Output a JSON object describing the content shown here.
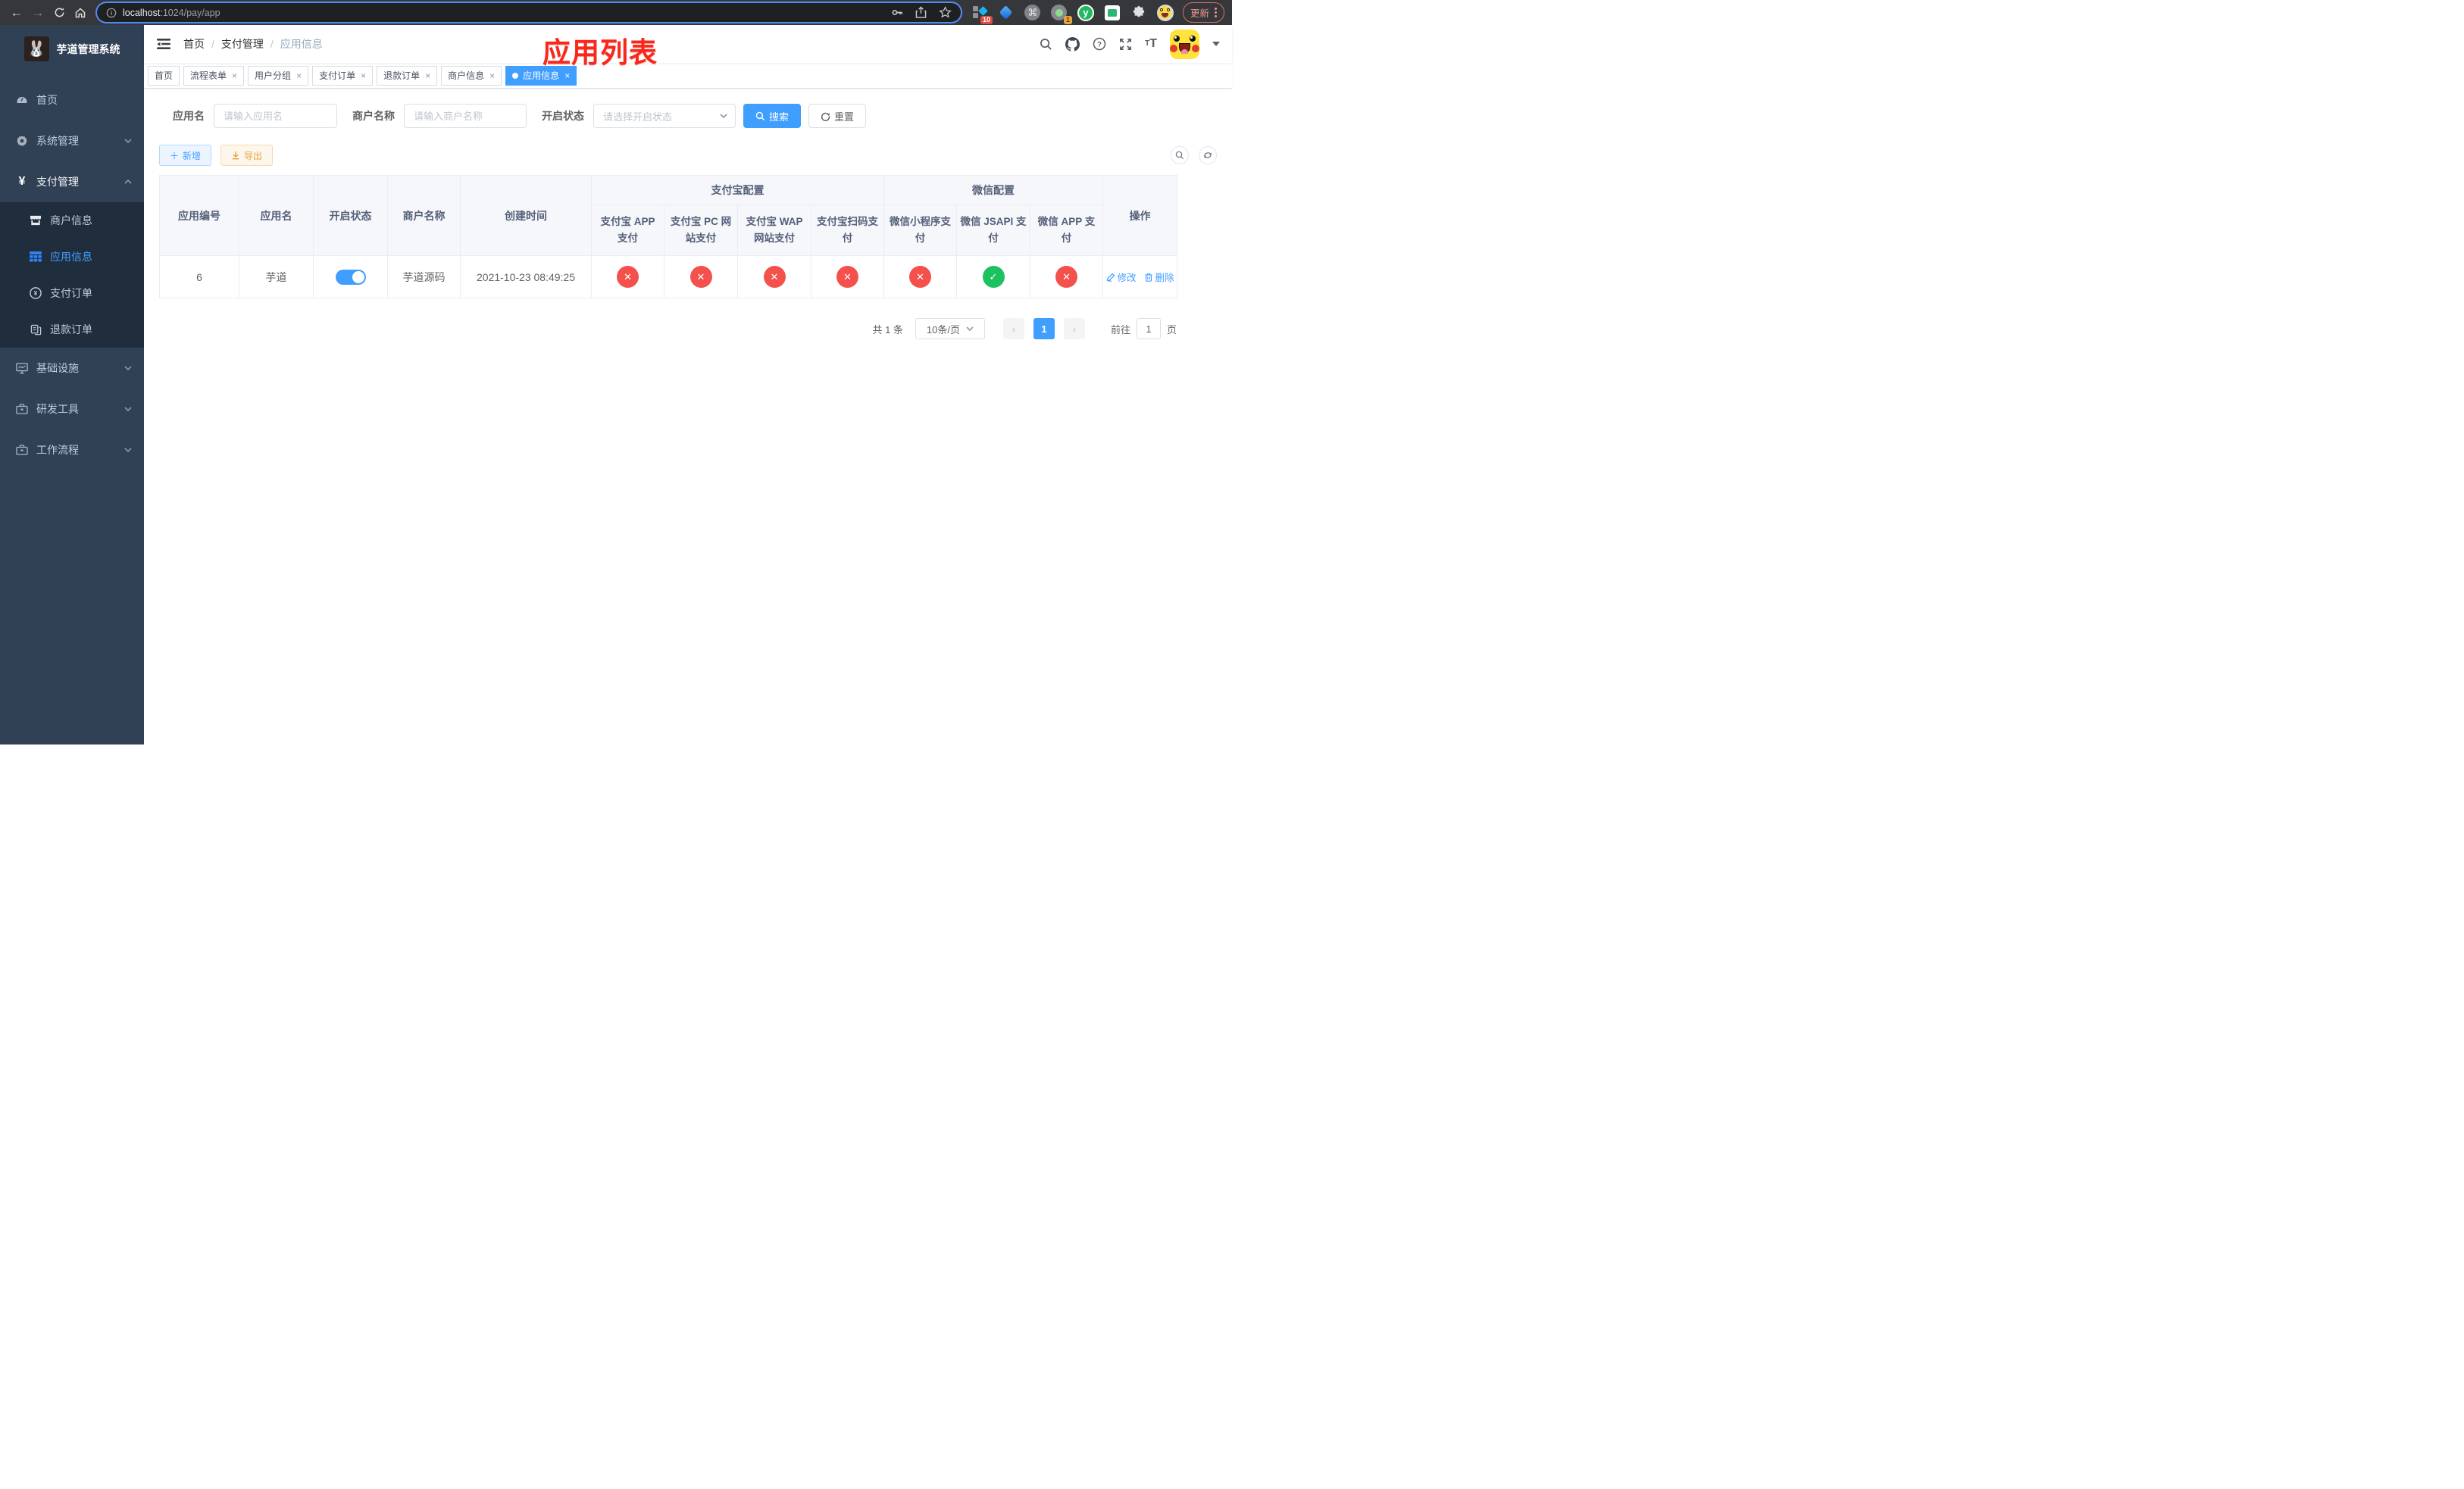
{
  "browser": {
    "url_host": "localhost",
    "url_rest": ":1024/pay/app",
    "ext_badge_1": "10",
    "ext_badge_2": "1",
    "ext_cmd_glyph": "⌘",
    "ext_y_glyph": "y",
    "update_label": "更新"
  },
  "annotation": {
    "text": "应用列表"
  },
  "sidebar": {
    "title": "芋道管理系统",
    "home": "首页",
    "system": "系统管理",
    "payment": "支付管理",
    "sub_merchant": "商户信息",
    "sub_app": "应用信息",
    "sub_pay_order": "支付订单",
    "sub_refund_order": "退款订单",
    "infra": "基础设施",
    "devtools": "研发工具",
    "workflow": "工作流程"
  },
  "breadcrumb": {
    "items": [
      "首页",
      "支付管理",
      "应用信息"
    ]
  },
  "tabs": {
    "list": [
      {
        "label": "首页"
      },
      {
        "label": "流程表单"
      },
      {
        "label": "用户分组"
      },
      {
        "label": "支付订单"
      },
      {
        "label": "退款订单"
      },
      {
        "label": "商户信息"
      },
      {
        "label": "应用信息"
      }
    ]
  },
  "filters": {
    "app_name_label": "应用名",
    "app_name_placeholder": "请输入应用名",
    "merchant_label": "商户名称",
    "merchant_placeholder": "请输入商户名称",
    "status_label": "开启状态",
    "status_placeholder": "请选择开启状态",
    "search_label": "搜索",
    "reset_label": "重置"
  },
  "toolbar": {
    "add_label": "新增",
    "export_label": "导出"
  },
  "table": {
    "columns": {
      "app_id": "应用编号",
      "app_name": "应用名",
      "status": "开启状态",
      "merchant": "商户名称",
      "created": "创建时间",
      "alipay_group": "支付宝配置",
      "wechat_group": "微信配置",
      "alipay_app": "支付宝 APP 支付",
      "alipay_pc": "支付宝 PC 网站支付",
      "alipay_wap": "支付宝 WAP 网站支付",
      "alipay_qr": "支付宝扫码支付",
      "wx_mini": "微信小程序支付",
      "wx_jsapi": "微信 JSAPI 支付",
      "wx_app": "微信 APP 支付",
      "actions": "操作"
    },
    "rows": [
      {
        "app_id": "6",
        "app_name": "芋道",
        "status_on": true,
        "merchant": "芋道源码",
        "created": "2021-10-23 08:49:25",
        "alipay_app": false,
        "alipay_pc": false,
        "alipay_wap": false,
        "alipay_qr": false,
        "wx_mini": false,
        "wx_jsapi": true,
        "wx_app": false,
        "edit_label": "修改",
        "delete_label": "删除"
      }
    ]
  },
  "pagination": {
    "total_text": "共 1 条",
    "page_size": "10条/页",
    "current_page": "1",
    "goto_label": "前往",
    "goto_value": "1",
    "page_unit": "页"
  },
  "colors": {
    "primary": "#409eff",
    "success": "#1ec15f",
    "danger": "#f4504c",
    "warning": "#e6a23c",
    "sidebar_bg": "#304156",
    "submenu_bg": "#1f2d3d"
  }
}
